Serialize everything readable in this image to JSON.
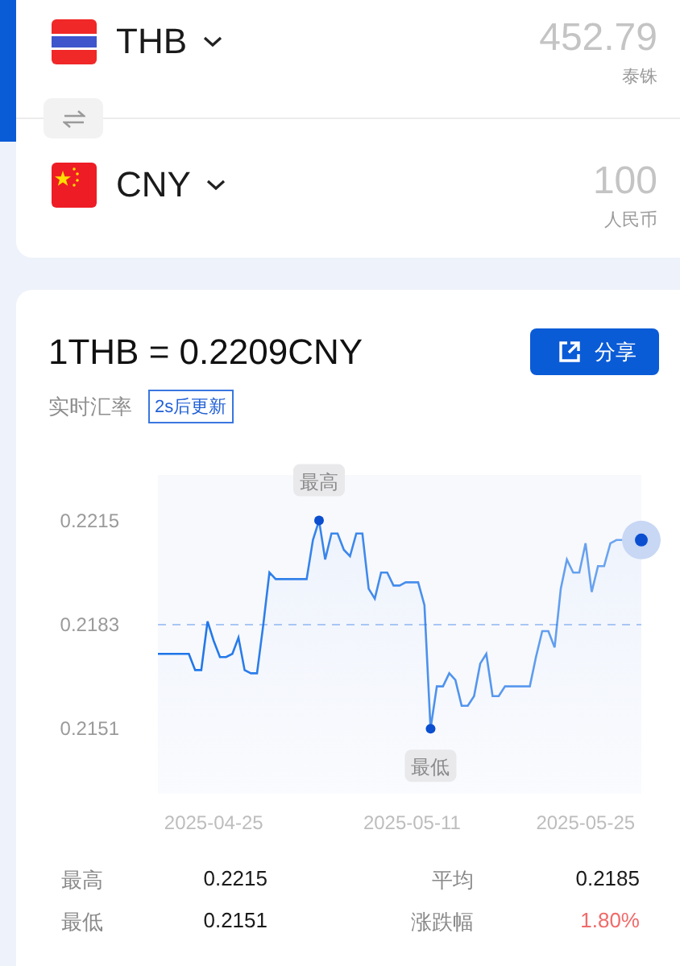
{
  "converter": {
    "rows": [
      {
        "code": "THB",
        "amount": "452.79",
        "currency_name": "泰铢"
      },
      {
        "code": "CNY",
        "amount": "100",
        "currency_name": "人民币"
      }
    ]
  },
  "rate": {
    "title": "1THB = 0.2209CNY",
    "share_button": "分享",
    "label": "实时汇率",
    "update_badge": "2s后更新"
  },
  "chart_data": {
    "type": "area",
    "categories": [
      null,
      null,
      null,
      null,
      null,
      null,
      null,
      null,
      null,
      "2025-04-25",
      null,
      null,
      null,
      null,
      null,
      null,
      null,
      null,
      null,
      null,
      null,
      null,
      null,
      null,
      null,
      null,
      null,
      null,
      null,
      null,
      null,
      null,
      null,
      null,
      null,
      null,
      null,
      null,
      null,
      null,
      null,
      "2025-05-11",
      null,
      null,
      null,
      null,
      null,
      null,
      null,
      null,
      null,
      null,
      null,
      null,
      null,
      null,
      null,
      null,
      null,
      null,
      null,
      null,
      null,
      null,
      null,
      null,
      null,
      null,
      null,
      "2025-05-25",
      null,
      null,
      null,
      null,
      null,
      null,
      null,
      null,
      null
    ],
    "series": [
      {
        "color": "#1a73e8",
        "values": [
          0.2174,
          0.2174,
          0.2174,
          0.2174,
          0.2174,
          0.2174,
          0.2169,
          0.2169,
          0.2184,
          0.2178,
          0.2173,
          0.2173,
          0.2174,
          0.2179,
          0.2169,
          0.2168,
          0.2168,
          0.2183,
          0.2199,
          0.2197,
          0.2197,
          0.2197,
          0.2197,
          0.2197,
          0.2197,
          0.2209,
          0.2215,
          0.2203,
          0.2211,
          0.2211,
          0.2206,
          0.2204,
          0.2211,
          0.2211,
          0.2194,
          0.2191,
          0.2199,
          0.2199,
          0.2195,
          0.2195,
          0.2196,
          0.2196,
          0.2196,
          0.2189,
          0.2151,
          0.2164,
          0.2164,
          0.2168,
          0.2166,
          0.2158,
          0.2158,
          0.2161,
          0.2171,
          0.2174,
          0.2161,
          0.2161,
          0.2164,
          0.2164,
          0.2164,
          0.2164,
          0.2164,
          0.2173,
          0.2181,
          0.2181,
          0.2176,
          0.2194,
          0.2203,
          0.2199,
          0.2199,
          0.2208,
          0.2193,
          0.2201,
          0.2201,
          0.2208,
          0.2209,
          0.2209,
          0.2209,
          0.2209,
          0.2209
        ]
      }
    ],
    "ylim": [
      0.2131,
      0.2229
    ],
    "ref_lines": [
      {
        "axis": "y",
        "value": 0.2183
      }
    ],
    "yticks": [
      {
        "value": 0.2215,
        "label": "0.2215"
      },
      {
        "value": 0.2183,
        "label": "0.2183"
      },
      {
        "value": 0.2151,
        "label": "0.2151"
      }
    ],
    "annotations": [
      {
        "y": 0.2215,
        "text": "最高"
      },
      {
        "y": 0.2151,
        "text": "最低"
      }
    ]
  },
  "stats": [
    [
      {
        "label": "最高",
        "value": "0.2215",
        "kind": "plain"
      },
      {
        "label": "平均",
        "value": "0.2185",
        "kind": "plain"
      }
    ],
    [
      {
        "label": "最低",
        "value": "0.2151",
        "kind": "plain"
      },
      {
        "label": "涨跌幅",
        "value": "1.80%",
        "kind": "change"
      }
    ]
  ]
}
